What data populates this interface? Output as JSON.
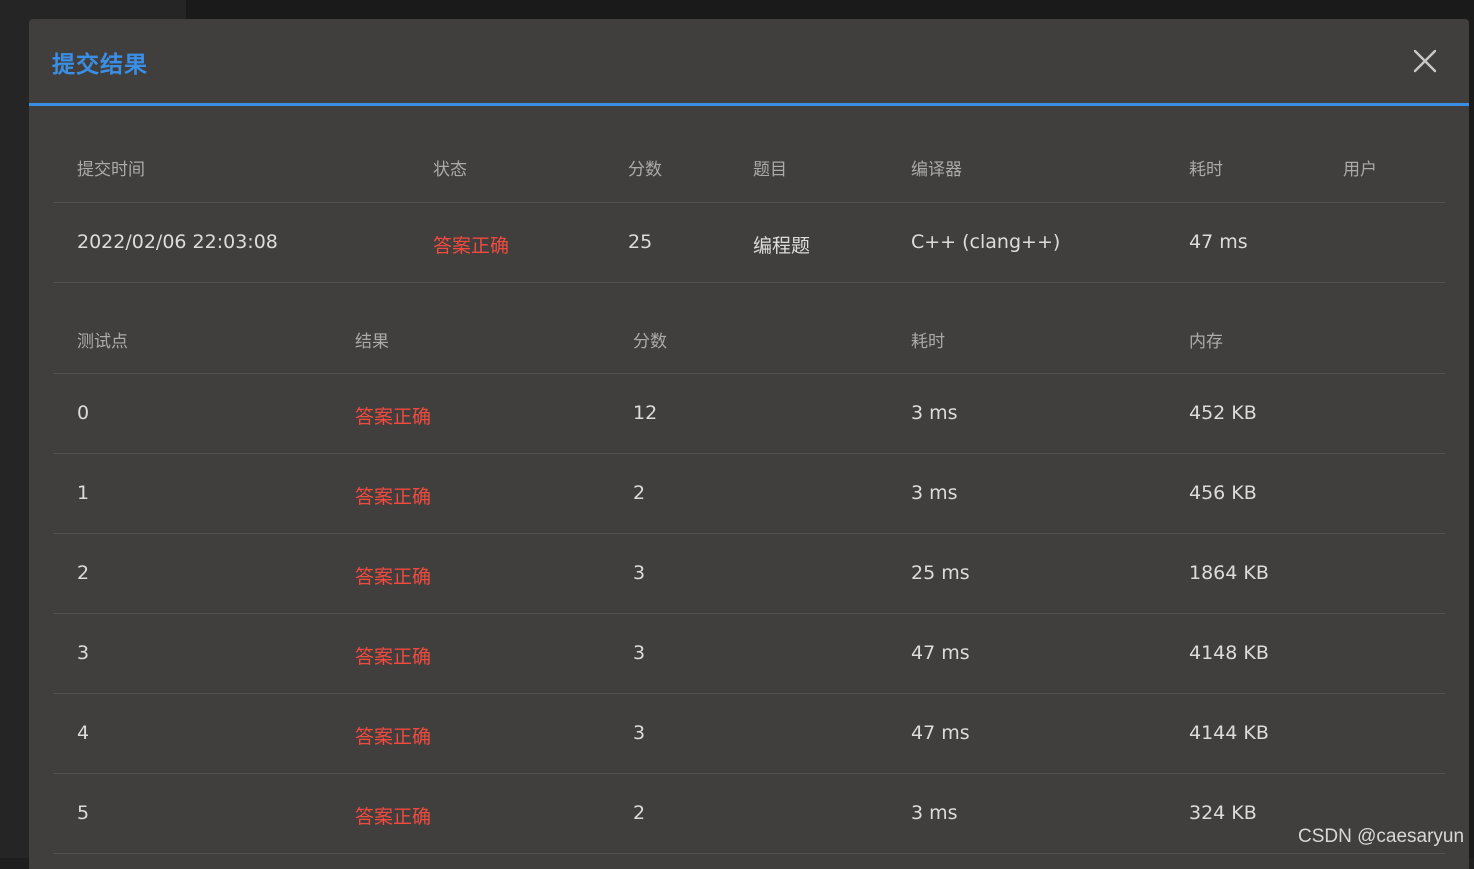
{
  "modal": {
    "title": "提交结果",
    "close_label": "×"
  },
  "summary": {
    "headers": [
      "提交时间",
      "状态",
      "分数",
      "题目",
      "编译器",
      "耗时",
      "用户"
    ],
    "row": {
      "time": "2022/02/06 22:03:08",
      "status": "答案正确",
      "score": "25",
      "problem": "编程题",
      "compiler": "C++ (clang++)",
      "duration": "47 ms",
      "user": ""
    }
  },
  "testcases": {
    "headers": [
      "测试点",
      "结果",
      "分数",
      "耗时",
      "内存"
    ],
    "rows": [
      {
        "id": "0",
        "result": "答案正确",
        "score": "12",
        "time": "3 ms",
        "memory": "452 KB"
      },
      {
        "id": "1",
        "result": "答案正确",
        "score": "2",
        "time": "3 ms",
        "memory": "456 KB"
      },
      {
        "id": "2",
        "result": "答案正确",
        "score": "3",
        "time": "25 ms",
        "memory": "1864 KB"
      },
      {
        "id": "3",
        "result": "答案正确",
        "score": "3",
        "time": "47 ms",
        "memory": "4148 KB"
      },
      {
        "id": "4",
        "result": "答案正确",
        "score": "3",
        "time": "47 ms",
        "memory": "4144 KB"
      },
      {
        "id": "5",
        "result": "答案正确",
        "score": "2",
        "time": "3 ms",
        "memory": "324 KB"
      }
    ]
  },
  "watermark": "CSDN @caesaryun",
  "colors": {
    "accent": "#3a8ee6",
    "success_status": "#f24a3f",
    "modal_bg": "#403f3d"
  }
}
